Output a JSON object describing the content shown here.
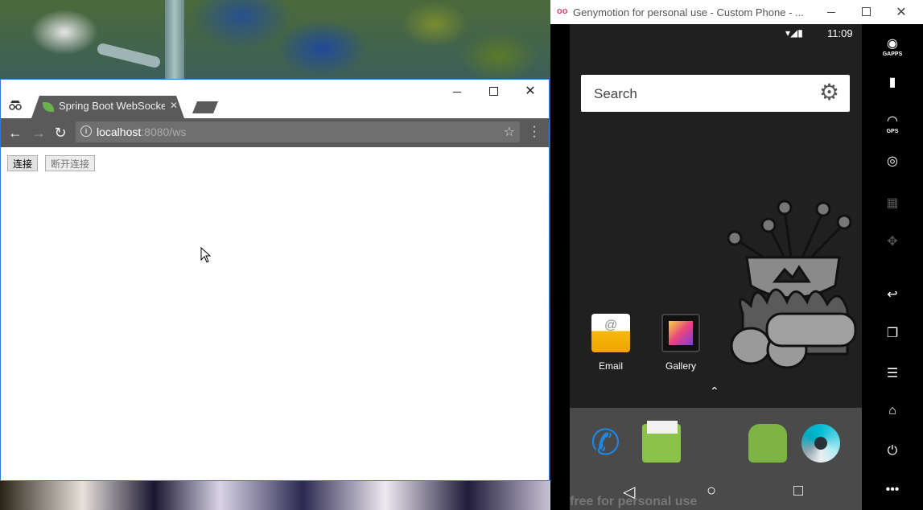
{
  "browser": {
    "tab_title": "Spring Boot WebSocke",
    "url_host": "localhost",
    "url_rest": ":8080/ws",
    "content": {
      "connect_label": "连接",
      "disconnect_label": "断开连接"
    }
  },
  "genymotion": {
    "window_title": "Genymotion for personal use - Custom Phone - ...",
    "status_time": "11:09",
    "search_placeholder": "Search",
    "apps": [
      {
        "label": "Email",
        "icon": "email-icon"
      },
      {
        "label": "Gallery",
        "icon": "gallery-icon"
      }
    ],
    "dock": [
      "phone-icon",
      "messaging-icon",
      "android-icon",
      "camera-icon"
    ],
    "watermark": "free for personal use",
    "sidebar": [
      {
        "label": "GAPPS",
        "icon": "gapps-icon"
      },
      {
        "label": "",
        "icon": "battery-icon"
      },
      {
        "label": "GPS",
        "icon": "gps-icon"
      },
      {
        "label": "",
        "icon": "webcam-icon"
      },
      {
        "label": "",
        "icon": "clapper-icon"
      },
      {
        "label": "",
        "icon": "dpad-icon"
      },
      {
        "label": "",
        "icon": "back-icon"
      },
      {
        "label": "",
        "icon": "recent-apps-icon"
      },
      {
        "label": "",
        "icon": "menu-icon"
      },
      {
        "label": "",
        "icon": "home-icon"
      },
      {
        "label": "",
        "icon": "power-icon"
      },
      {
        "label": "",
        "icon": "more-icon"
      }
    ]
  },
  "colors": {
    "browser_chrome": "#5a5a5a",
    "window_border": "#2d7bd6",
    "phone_bg": "#202020",
    "dock_bg": "#4a4a4a"
  }
}
